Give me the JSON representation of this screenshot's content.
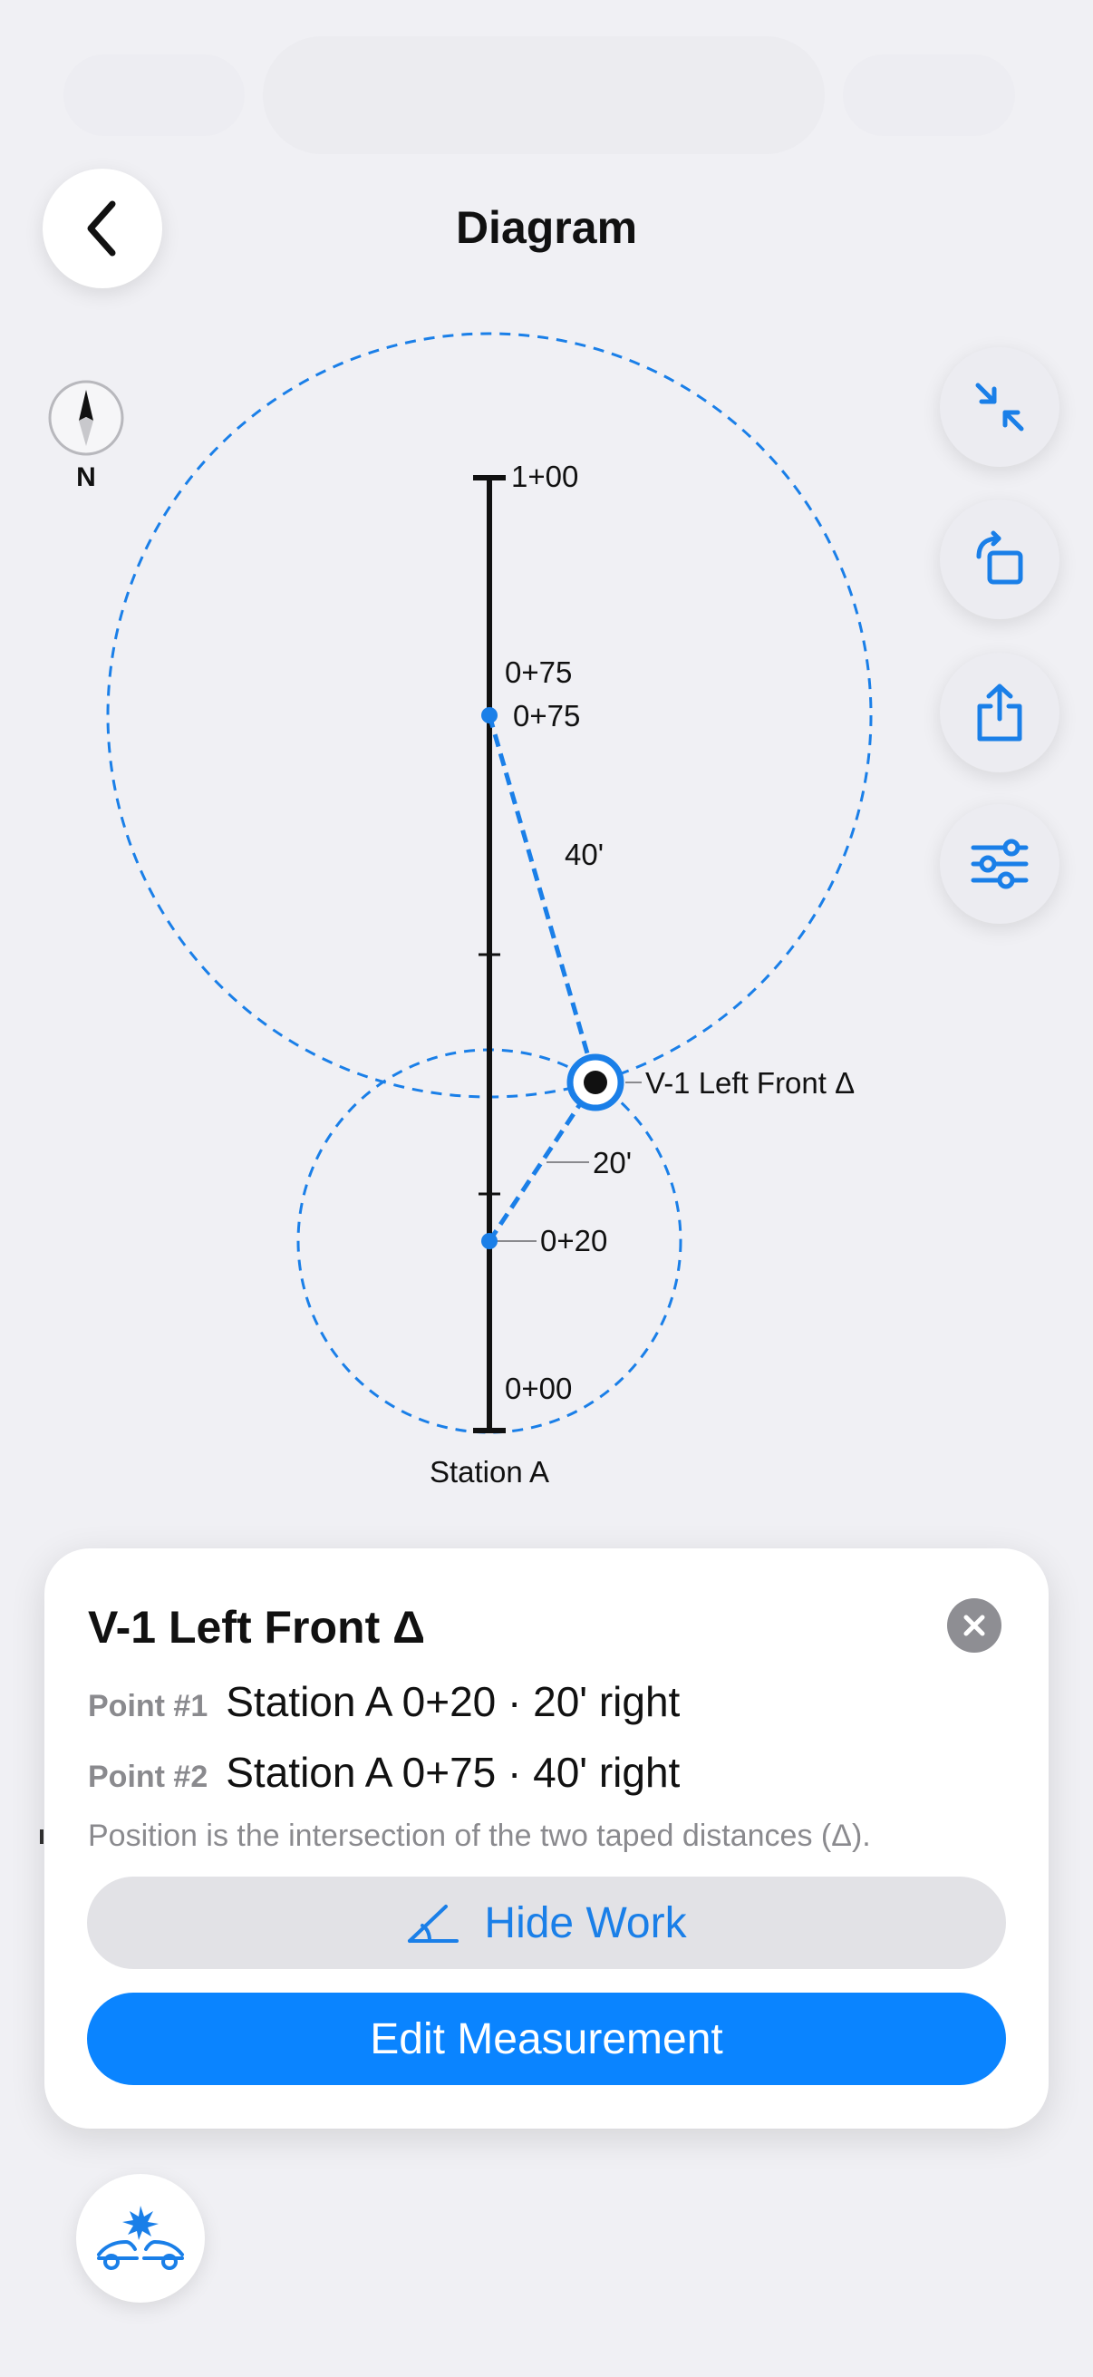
{
  "header": {
    "title": "Diagram",
    "back_icon": "chevron-left-icon"
  },
  "compass": {
    "label": "N"
  },
  "toolbar": {
    "buttons": [
      {
        "icon": "collapse-arrows-icon"
      },
      {
        "icon": "rotate-icon"
      },
      {
        "icon": "share-icon"
      },
      {
        "icon": "sliders-icon"
      }
    ]
  },
  "diagram": {
    "baseline_name": "Station A",
    "stations": {
      "top": "1+00",
      "upper_label": "0+75",
      "upper_point": "0+75",
      "lower_point": "0+20",
      "bottom": "0+00"
    },
    "distances": {
      "upper": "40'",
      "lower": "20'"
    },
    "vehicle_point_label": "V-1 Left Front Δ"
  },
  "card": {
    "title": "V-1 Left Front Δ",
    "point1_label": "Point #1",
    "point1_value": "Station A 0+20 · 20' right",
    "point2_label": "Point #2",
    "point2_value": "Station A 0+75 · 40' right",
    "note": "Position is the intersection of the two taped distances (Δ).",
    "hide_work_label": "Hide Work",
    "edit_label": "Edit Measurement",
    "close_icon": "close-icon"
  },
  "bottom_button": {
    "icon": "vehicle-collision-icon"
  },
  "colors": {
    "accent": "#0a84ff",
    "background": "#f0f0f4",
    "diagram_blue": "#1a7fe8"
  }
}
